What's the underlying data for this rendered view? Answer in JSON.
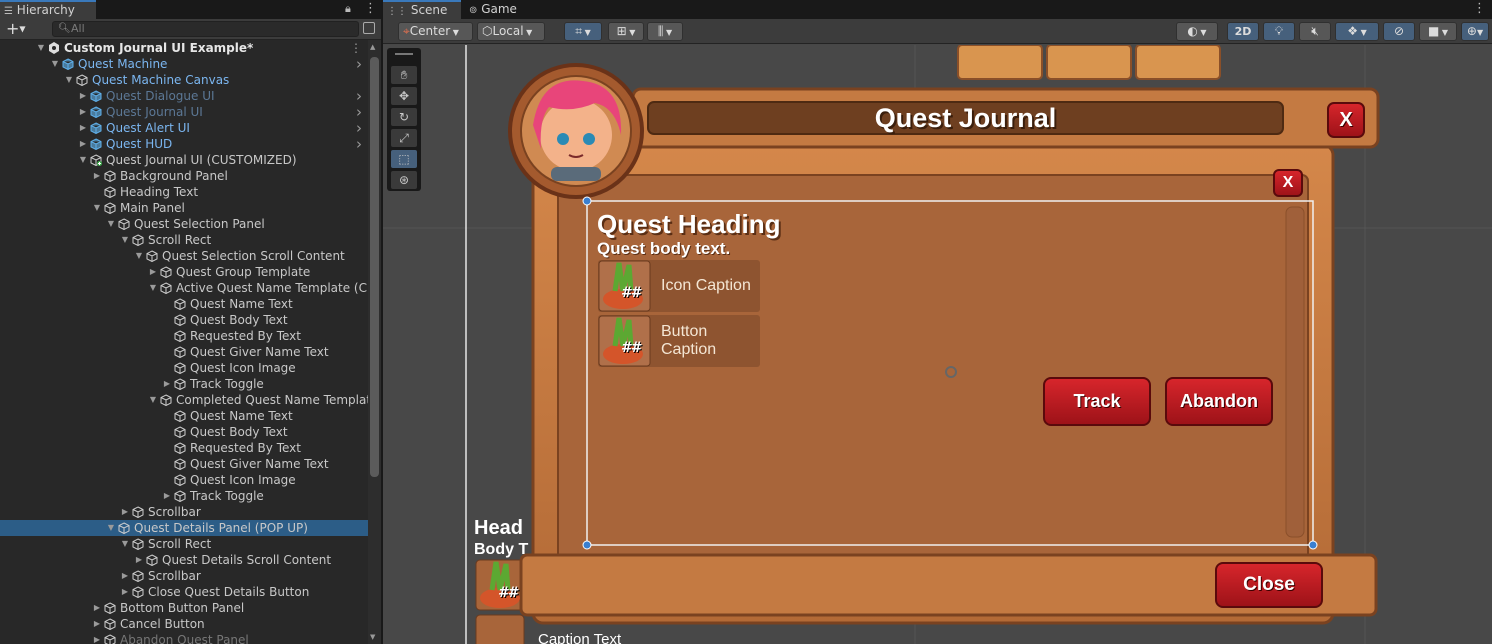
{
  "hierarchy": {
    "tab": "Hierarchy",
    "search_placeholder": "All",
    "rows": [
      {
        "label": "Custom Journal UI Example*",
        "indent": 0,
        "arrow": "▼",
        "style": "bold",
        "icon": "unity",
        "more": true
      },
      {
        "label": "Quest Machine",
        "indent": 1,
        "arrow": "▼",
        "style": "cyan",
        "icon": "cube-blue",
        "chev": true
      },
      {
        "label": "Quest Machine Canvas",
        "indent": 2,
        "arrow": "▼",
        "style": "cyan",
        "icon": "cube"
      },
      {
        "label": "Quest Dialogue UI",
        "indent": 3,
        "arrow": "▶",
        "style": "dim",
        "icon": "cube-blue",
        "chev": true
      },
      {
        "label": "Quest Journal UI",
        "indent": 3,
        "arrow": "▶",
        "style": "dim",
        "icon": "cube-blue",
        "chev": true
      },
      {
        "label": "Quest Alert UI",
        "indent": 3,
        "arrow": "▶",
        "style": "cyan",
        "icon": "cube-blue",
        "chev": true
      },
      {
        "label": "Quest HUD",
        "indent": 3,
        "arrow": "▶",
        "style": "cyan",
        "icon": "cube-blue",
        "chev": true
      },
      {
        "label": "Quest Journal UI (CUSTOMIZED)",
        "indent": 3,
        "arrow": "▼",
        "style": "normal",
        "icon": "cube-plus"
      },
      {
        "label": "Background Panel",
        "indent": 4,
        "arrow": "▶",
        "style": "normal",
        "icon": "cube"
      },
      {
        "label": "Heading Text",
        "indent": 4,
        "arrow": "",
        "style": "normal",
        "icon": "cube"
      },
      {
        "label": "Main Panel",
        "indent": 4,
        "arrow": "▼",
        "style": "normal",
        "icon": "cube"
      },
      {
        "label": "Quest Selection Panel",
        "indent": 5,
        "arrow": "▼",
        "style": "normal",
        "icon": "cube"
      },
      {
        "label": "Scroll Rect",
        "indent": 6,
        "arrow": "▼",
        "style": "normal",
        "icon": "cube"
      },
      {
        "label": "Quest Selection Scroll Content",
        "indent": 7,
        "arrow": "▼",
        "style": "normal",
        "icon": "cube"
      },
      {
        "label": "Quest Group Template",
        "indent": 8,
        "arrow": "▶",
        "style": "normal",
        "icon": "cube"
      },
      {
        "label": "Active Quest Name Template (CUSTOMIZED)",
        "indent": 8,
        "arrow": "▼",
        "style": "normal",
        "icon": "cube"
      },
      {
        "label": "Quest Name Text",
        "indent": 9,
        "arrow": "",
        "style": "normal",
        "icon": "cube"
      },
      {
        "label": "Quest Body Text",
        "indent": 9,
        "arrow": "",
        "style": "normal",
        "icon": "cube"
      },
      {
        "label": "Requested By Text",
        "indent": 9,
        "arrow": "",
        "style": "normal",
        "icon": "cube"
      },
      {
        "label": "Quest Giver Name Text",
        "indent": 9,
        "arrow": "",
        "style": "normal",
        "icon": "cube"
      },
      {
        "label": "Quest Icon Image",
        "indent": 9,
        "arrow": "",
        "style": "normal",
        "icon": "cube"
      },
      {
        "label": "Track Toggle",
        "indent": 9,
        "arrow": "▶",
        "style": "normal",
        "icon": "cube"
      },
      {
        "label": "Completed Quest Name Template",
        "indent": 8,
        "arrow": "▼",
        "style": "normal",
        "icon": "cube"
      },
      {
        "label": "Quest Name Text",
        "indent": 9,
        "arrow": "",
        "style": "normal",
        "icon": "cube"
      },
      {
        "label": "Quest Body Text",
        "indent": 9,
        "arrow": "",
        "style": "normal",
        "icon": "cube"
      },
      {
        "label": "Requested By Text",
        "indent": 9,
        "arrow": "",
        "style": "normal",
        "icon": "cube"
      },
      {
        "label": "Quest Giver Name Text",
        "indent": 9,
        "arrow": "",
        "style": "normal",
        "icon": "cube"
      },
      {
        "label": "Quest Icon Image",
        "indent": 9,
        "arrow": "",
        "style": "normal",
        "icon": "cube"
      },
      {
        "label": "Track Toggle",
        "indent": 9,
        "arrow": "▶",
        "style": "normal",
        "icon": "cube"
      },
      {
        "label": "Scrollbar",
        "indent": 6,
        "arrow": "▶",
        "style": "normal",
        "icon": "cube"
      },
      {
        "label": "Quest Details Panel (POP UP)",
        "indent": 5,
        "arrow": "▼",
        "style": "normal",
        "icon": "cube",
        "selected": true
      },
      {
        "label": "Scroll Rect",
        "indent": 6,
        "arrow": "▼",
        "style": "normal",
        "icon": "cube"
      },
      {
        "label": "Quest Details Scroll Content",
        "indent": 7,
        "arrow": "▶",
        "style": "normal",
        "icon": "cube"
      },
      {
        "label": "Scrollbar",
        "indent": 6,
        "arrow": "▶",
        "style": "normal",
        "icon": "cube"
      },
      {
        "label": "Close Quest Details Button",
        "indent": 6,
        "arrow": "▶",
        "style": "normal",
        "icon": "cube"
      },
      {
        "label": "Bottom Button Panel",
        "indent": 4,
        "arrow": "▶",
        "style": "normal",
        "icon": "cube"
      },
      {
        "label": "Cancel Button",
        "indent": 4,
        "arrow": "▶",
        "style": "normal",
        "icon": "cube"
      },
      {
        "label": "Abandon Quest Panel",
        "indent": 4,
        "arrow": "▶",
        "style": "gray",
        "icon": "cube"
      }
    ]
  },
  "scene": {
    "tabs": [
      "Scene",
      "Game"
    ],
    "pivot": "Center",
    "space": "Local",
    "mode_2d": "2D"
  },
  "journal": {
    "title": "Quest Journal",
    "close_x": "X",
    "details_close_x": "X",
    "heading": "Quest Heading",
    "body": "Quest body text.",
    "icon_caption": "Icon Caption",
    "button_caption_1": "Button",
    "button_caption_2": "Caption",
    "icon_badge": "##",
    "track": "Track",
    "abandon": "Abandon",
    "close": "Close",
    "bg_heading": "Head",
    "bg_body": "Body T",
    "bg_caption": "Caption Text"
  },
  "colors": {
    "wood": "#c47a42",
    "wood_dark": "#8a4f28",
    "panel": "#a8653a",
    "button_red": "#b8161e",
    "selection": "#2c5d87"
  }
}
